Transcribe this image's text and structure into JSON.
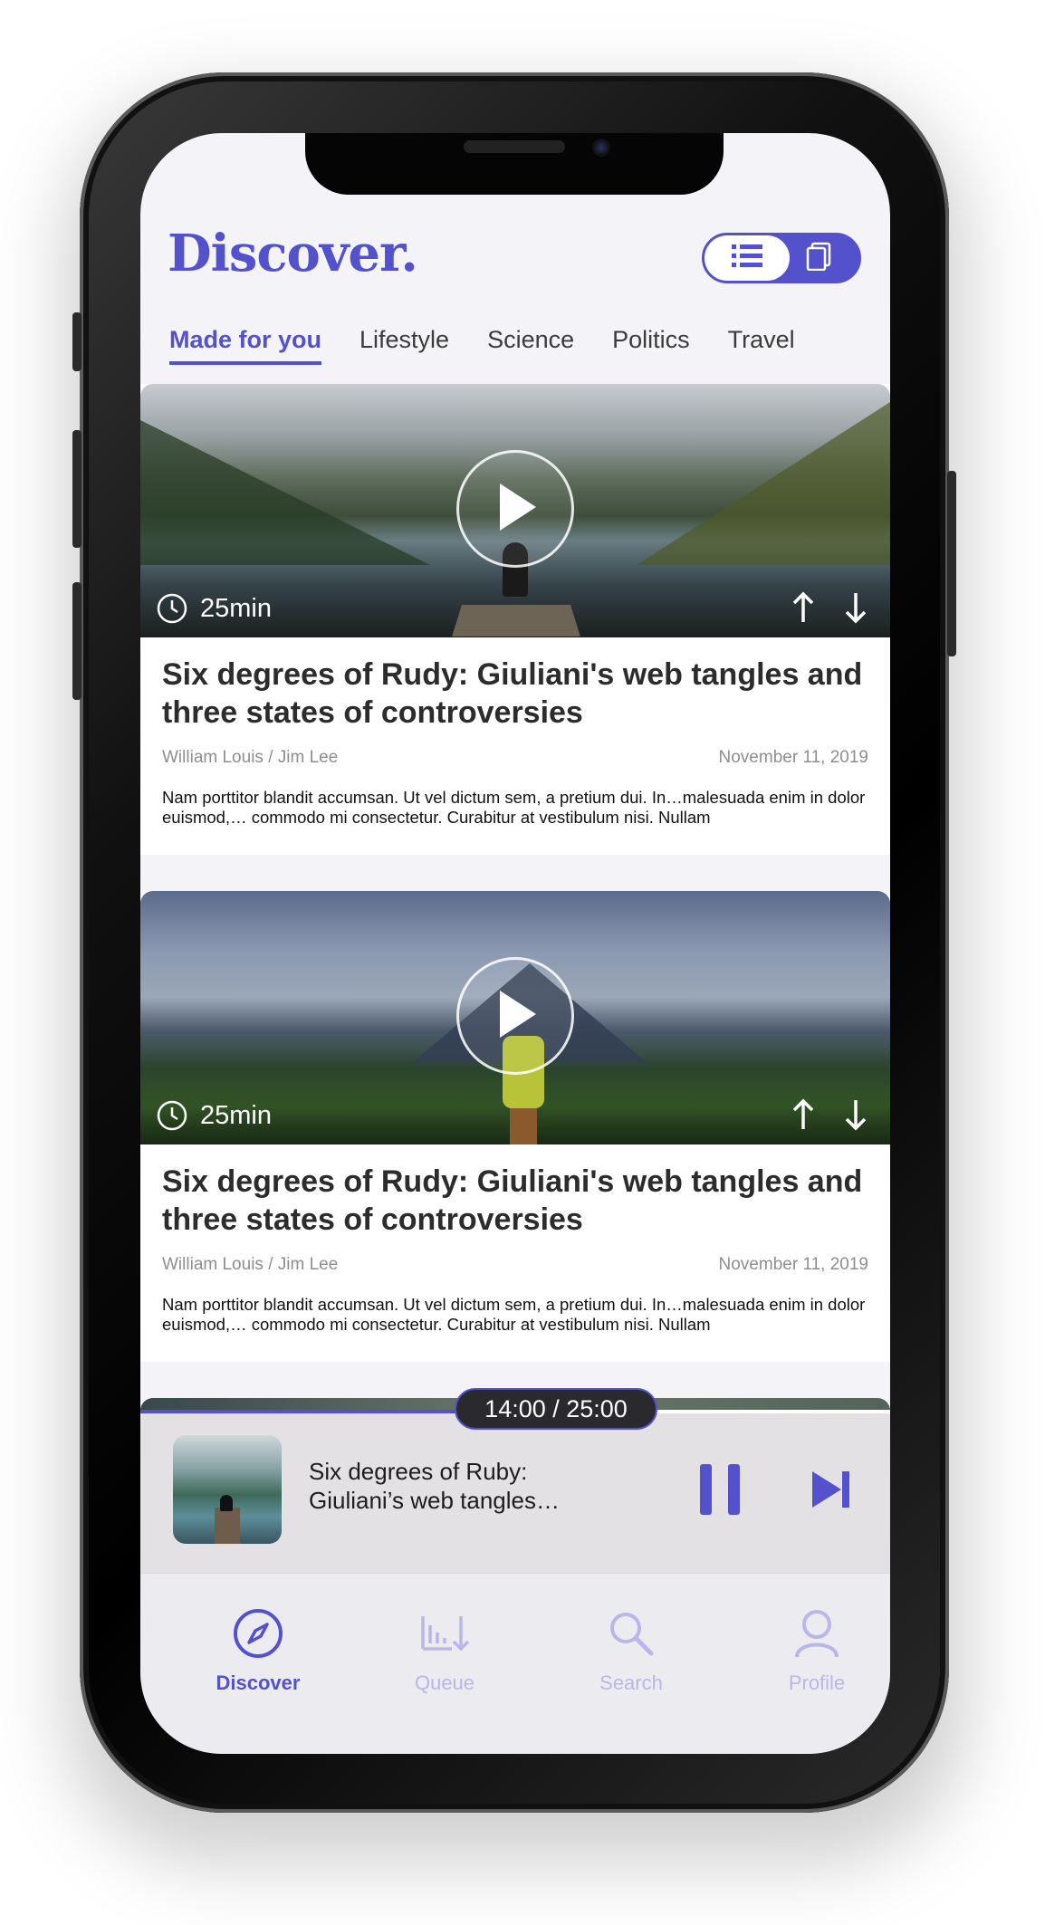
{
  "app": {
    "logo": "Discover.",
    "accent_color": "#5451cc"
  },
  "view_toggle": {
    "options": [
      {
        "icon": "list-icon",
        "selected": true
      },
      {
        "icon": "cards-icon",
        "selected": false
      }
    ]
  },
  "tabs": [
    {
      "label": "Made for you",
      "active": true
    },
    {
      "label": "Lifestyle",
      "active": false
    },
    {
      "label": "Science",
      "active": false
    },
    {
      "label": "Politics",
      "active": false
    },
    {
      "label": "Travel",
      "active": false
    }
  ],
  "articles": [
    {
      "duration": "25min",
      "title": "Six degrees of Rudy: Giuliani's web tangles and three states of controversies",
      "authors": "William Louis / Jim Lee",
      "date": "November 11, 2019",
      "excerpt": "Nam porttitor blandit accumsan. Ut vel dictum sem, a pretium dui. In…malesuada enim in dolor euismod,… commodo mi consectetur. Curabitur at vestibulum nisi. Nullam"
    },
    {
      "duration": "25min",
      "title": "Six degrees of Rudy: Giuliani's web tangles and three states of controversies",
      "authors": "William Louis / Jim Lee",
      "date": "November 11, 2019",
      "excerpt": "Nam porttitor blandit accumsan. Ut vel dictum sem, a pretium dui. In…malesuada enim in dolor euismod,… commodo mi consectetur. Curabitur at vestibulum nisi. Nullam"
    }
  ],
  "player": {
    "time": "14:00 / 25:00",
    "progress": 0.56,
    "title_line1": "Six degrees of Ruby:",
    "title_line2": "Giuliani’s web tangles…"
  },
  "bottom_nav": [
    {
      "label": "Discover",
      "icon": "compass-icon",
      "active": true
    },
    {
      "label": "Queue",
      "icon": "queue-icon",
      "active": false
    },
    {
      "label": "Search",
      "icon": "search-icon",
      "active": false
    },
    {
      "label": "Profile",
      "icon": "profile-icon",
      "active": false
    }
  ]
}
